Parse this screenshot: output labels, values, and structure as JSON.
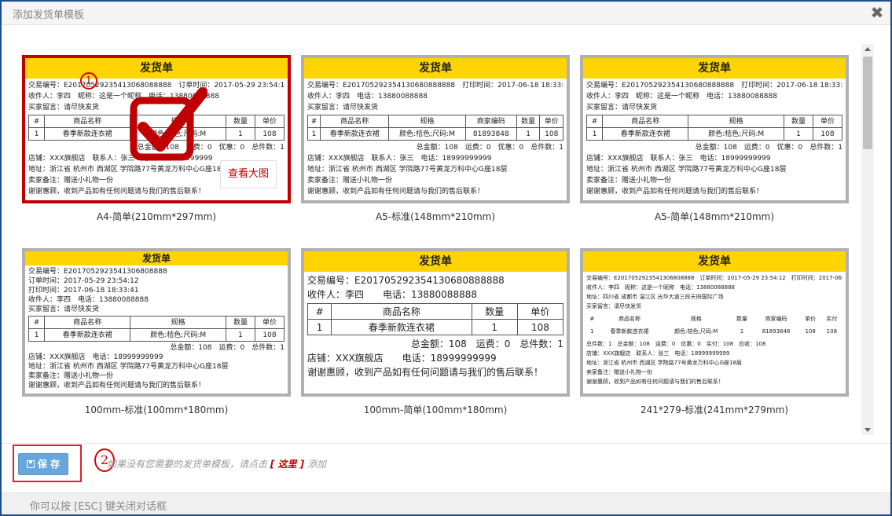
{
  "dialog": {
    "title": "添加发货单模板",
    "close_glyph": "✖"
  },
  "thumbnail": {
    "doc_title": "发货单",
    "view_large": "查看大图",
    "badge_1": "1",
    "badge_2": "2"
  },
  "templates": [
    {
      "name": "A4-简单(210mm*297mm)",
      "lines_top": [
        "交易编号：E201705292354130680888​88　订单时间：2017-05-29 23:54:12　打印时间：2017-06-18 18:33:41",
        "收件人：李四　昵称：这是一个昵称　电话：13880088888",
        "买家留言：请尽快发货"
      ],
      "table": [
        [
          "#",
          "商品名称",
          "规格",
          "数量",
          "单价"
        ],
        [
          "1",
          "春季新款连衣裙",
          "颜色:桔色;尺码:M",
          "1",
          "108"
        ]
      ],
      "lines_bottom": [
        "总金额：108　运费：0　优惠：0　总件数：1",
        "店铺：XXX旗舰店　联系人：张三　电话：18999999999",
        "地址：浙江省 杭州市 西湖区 学院路77号黄龙万科中心G座18层",
        "卖家备注：赠送小礼物一份",
        "谢谢惠顾，收到产品如有任何问题请与我们的售后联系！"
      ]
    },
    {
      "name": "A5-标准(148mm*210mm)",
      "lines_top": [
        "交易编号：E20170529235413068088​8888　打印时间：2017-06-18 18:33:41",
        "收件人：李四　电话：13880088888",
        "买家留言：请尽快发货"
      ],
      "table": [
        [
          "#",
          "商品名称",
          "规格",
          "商家编码",
          "数量",
          "单价"
        ],
        [
          "1",
          "春季新款连衣裙",
          "颜色:桔色;尺码:M",
          "81893848",
          "1",
          "108"
        ]
      ],
      "lines_bottom": [
        "总金额：108　运费：0　优惠：0　总件数：1",
        "店铺：XXX旗舰店　联系人：张三　电话：18999999999",
        "地址：浙江省 杭州市 西湖区 学院路77号黄龙万科中心G座18层",
        "卖家备注：赠送小礼物一份",
        "谢谢惠顾，收到产品如有任何问题请与我们的售后联系！"
      ]
    },
    {
      "name": "A5-简单(148mm*210mm)",
      "lines_top": [
        "交易编号：E20170529235413068088​8888　打印时间：2017-06-18 18:33:41",
        "收件人：李四　昵称：这是一个昵称　电话：13880088888",
        "买家留言：请尽快发货"
      ],
      "table": [
        [
          "#",
          "商品名称",
          "规格",
          "数量",
          "单价"
        ],
        [
          "1",
          "春季新款连衣裙",
          "颜色:桔色;尺码:M",
          "1",
          "108"
        ]
      ],
      "lines_bottom": [
        "总金额：108　运费：0　优惠：0　总件数：1",
        "店铺：XXX旗舰店　联系人：张三　电话：18999999999",
        "地址：浙江省 杭州市 西湖区 学院路77号黄龙万科中心G座18层",
        "卖家备注：赠送小礼物一份",
        "谢谢惠顾，收到产品如有任何问题请与我们的售后联系！"
      ]
    },
    {
      "name": "100mm-标准(100mm*180mm)",
      "lines_top": [
        "交易编号：E20170529235413068088​88",
        "订单时间：2017-05-29 23:54:12",
        "打印时间：2017-06-18 18:33:41",
        "收件人：李四　电话：13880088888",
        "买家留言：请尽快发货"
      ],
      "table": [
        [
          "#",
          "商品名称",
          "规格",
          "数量",
          "单价"
        ],
        [
          "1",
          "春季新款连衣裙",
          "颜色:桔色;尺码:M",
          "1",
          "108"
        ]
      ],
      "lines_bottom": [
        "总金额：108　运费：0　总件数：1",
        "店铺：XXX旗舰店　电话：18999999999",
        "地址：浙江省 杭州市 西湖区 学院路77号黄龙万科中心G座18层",
        "卖家备注：赠送小礼物一份",
        "谢谢惠顾，收到产品如有任何问题请与我们的售后联系！"
      ]
    },
    {
      "name": "100mm-简单(100mm*180mm)",
      "lines_top": [
        "交易编号：E20170529235413068088​8888",
        "收件人：李四　　电话：13880088888"
      ],
      "table": [
        [
          "#",
          "商品名称",
          "数量",
          "单价"
        ],
        [
          "1",
          "春季新款连衣裙",
          "1",
          "108"
        ]
      ],
      "lines_bottom": [
        "总金额：108　运费：0　总件数：1",
        "店铺：XXX旗舰店　　电话：18999999999",
        "谢谢惠顾，收到产品如有任何问题请与我们的售后联系！"
      ]
    },
    {
      "name": "241*279-标准(241mm*279mm)",
      "lines_top": [
        "交易编号：E20170529235413068088​88　订单时间：2017-05-29 23:54:12　打印时间：2017-06-18 18:33:41",
        "收件人：李四　昵称：这是一个昵称　电话：13880088888",
        "地址：四川省 成都市 温江区 光华大道三段天府国际广场",
        "买家留言：请尽快发货"
      ],
      "table": [
        [
          "#",
          "商品名称",
          "规格",
          "数量",
          "商家编码",
          "单价",
          "实付"
        ],
        [
          "1",
          "春季新款连衣裙",
          "颜色:桔色;尺码:M",
          "1",
          "81893848",
          "108",
          "108"
        ]
      ],
      "lines_bottom": [
        "总件数：1　总金额：108　运费：0　优惠：0　实付：108　应收：108",
        "店铺：XXX旗舰店　联系人：张三　电话：18999999999",
        "地址：浙江省 杭州市 西湖区 学院路77号黄龙万科中心G座18层",
        "卖家备注：赠送小礼物一份",
        "谢谢惠顾，收到产品如有任何问题请与我们的售后联系！"
      ]
    }
  ],
  "footer": {
    "save_label": "保 存",
    "hint_before": "如果没有您需要的发货单模板，请点击",
    "hint_link": "[ 这里 ]",
    "hint_after": "添加",
    "esc_hint": "你可以按 [ESC] 键关闭对话框"
  },
  "colors": {
    "header_yellow": "#ffd400",
    "selected_border": "#c00000",
    "save_button": "#69a6dc",
    "dialog_border": "#1f4e8c"
  },
  "selected_template_index": 0
}
